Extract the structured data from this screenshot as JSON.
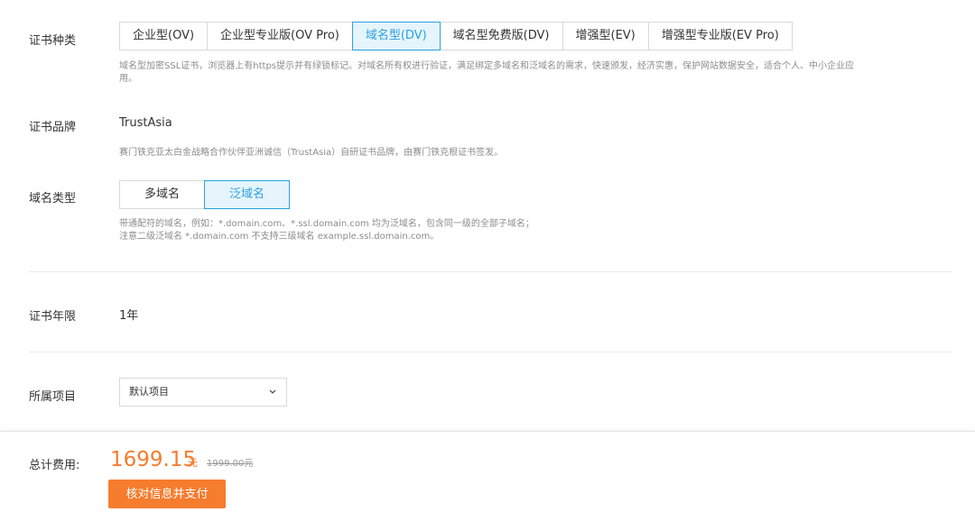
{
  "cert_type": {
    "label": "证书种类",
    "options": [
      "企业型(OV)",
      "企业型专业版(OV Pro)",
      "域名型(DV)",
      "域名型免费版(DV)",
      "增强型(EV)",
      "增强型专业版(EV Pro)"
    ],
    "selected_index": 2,
    "help_line1": "域名型加密SSL证书，浏览器上有https提示并有绿锁标记。对域名所有权进行验证，满足绑定多域名和泛域名的需求，快速颁发，经济实惠，保护网站数据安全，适合个人、中小企业应",
    "help_line2": "用。"
  },
  "cert_brand": {
    "label": "证书品牌",
    "value": "TrustAsia",
    "help": "赛门铁克亚太白金战略合作伙伴亚洲诚信（TrustAsia）自研证书品牌，由赛门铁克根证书签发。"
  },
  "domain_type": {
    "label": "域名类型",
    "options": [
      "多域名",
      "泛域名"
    ],
    "selected_index": 1,
    "help_line1": "带通配符的域名，例如：*.domain.com、*.ssl.domain.com 均为泛域名，包含同一级的全部子域名；",
    "help_line2": "注意二级泛域名 *.domain.com 不支持三级域名 example.ssl.domain.com。"
  },
  "cert_years": {
    "label": "证书年限",
    "value": "1年"
  },
  "project": {
    "label": "所属项目",
    "selected": "默认项目",
    "icon": "chevron-down-icon"
  },
  "footer": {
    "total_label": "总计费用:",
    "price": "1699.15",
    "unit": "元",
    "original_price": "1999.00元",
    "pay_button": "核对信息并支付"
  },
  "colors": {
    "accent": "#2aa1e0",
    "orange": "#f67c2e"
  }
}
